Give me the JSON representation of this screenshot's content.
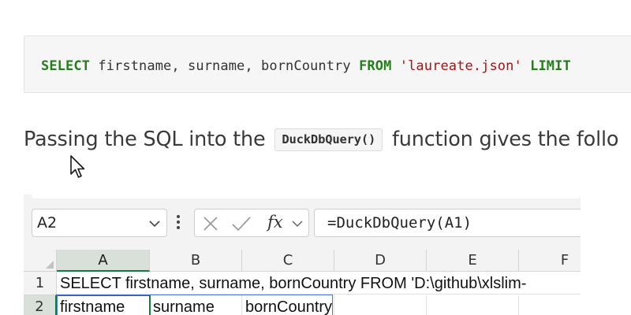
{
  "code": {
    "kw_select": "SELECT",
    "columns": " firstname, surname, bornCountry ",
    "kw_from": "FROM",
    "string": "'laureate.json'",
    "kw_limit": "LIMIT"
  },
  "paragraph": {
    "before": "Passing the SQL into the ",
    "code": "DuckDbQuery()",
    "after": " function gives the follo"
  },
  "excel": {
    "name_box": "A2",
    "fx": "fx",
    "formula": "=DuckDbQuery(A1)",
    "columns": [
      "A",
      "B",
      "C",
      "D",
      "E",
      "F"
    ],
    "rows": [
      "1",
      "2"
    ],
    "cells": {
      "a1": "SELECT firstname, surname, bornCountry FROM 'D:\\github\\xlslim-",
      "a2": "firstname",
      "b2": "surname",
      "c2": "bornCountry"
    },
    "accent_color": "#107c41",
    "icons": [
      "chevron-down-icon",
      "more-vertical-icon",
      "cancel-icon",
      "enter-check-icon",
      "insert-function-icon"
    ]
  },
  "colors": {
    "keyword": "#267d1e",
    "string": "#a31515",
    "text": "#3a3a3a"
  }
}
